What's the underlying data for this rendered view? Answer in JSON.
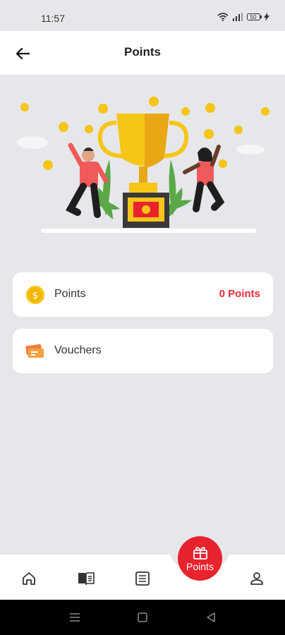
{
  "status_bar": {
    "time": "11:57",
    "battery": "50"
  },
  "header": {
    "title": "Points"
  },
  "cards": {
    "points": {
      "label": "Points",
      "value": "0 Points"
    },
    "vouchers": {
      "label": "Vouchers"
    }
  },
  "bottom_nav": {
    "items": [
      {
        "icon": "home-icon"
      },
      {
        "icon": "book-icon"
      },
      {
        "icon": "list-icon"
      },
      {
        "icon": "gift-icon",
        "label": "Points",
        "active": true
      },
      {
        "icon": "profile-icon"
      }
    ]
  },
  "colors": {
    "accent": "#e8232e",
    "points_value": "#e62b3a",
    "background": "#e6e7ea",
    "trophy": "#f5c518"
  }
}
